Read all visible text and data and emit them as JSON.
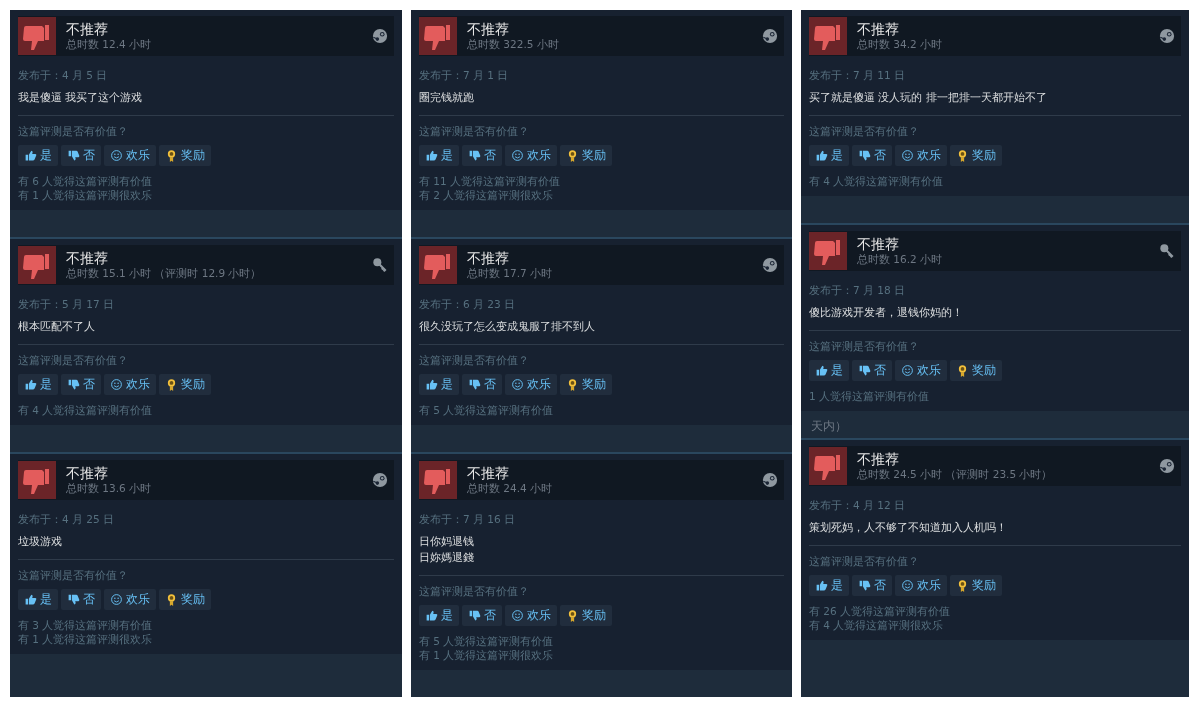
{
  "columns": [
    {
      "items": [
        {
          "kind": "review",
          "title": "不推荐",
          "hours": "总时数 12.4 小时",
          "key_activated": false,
          "date": "发布于：4 月 5 日",
          "text": "我是傻逼 我买了这个游戏",
          "question": "这篇评测是否有价值？",
          "buttons": [
            {
              "kind": "yes",
              "label": "是"
            },
            {
              "kind": "no",
              "label": "否"
            },
            {
              "kind": "funny",
              "label": "欢乐"
            },
            {
              "kind": "award",
              "label": "奖励"
            }
          ],
          "counts": [
            "有 6 人觉得这篇评测有价值",
            "有 1 人觉得这篇评测很欢乐"
          ]
        },
        {
          "kind": "gap"
        },
        {
          "kind": "review",
          "title": "不推荐",
          "hours": "总时数 15.1 小时 （评测时 12.9 小时）",
          "key_activated": true,
          "date": "发布于：5 月 17 日",
          "text": "根本匹配不了人",
          "question": "这篇评测是否有价值？",
          "buttons": [
            {
              "kind": "yes",
              "label": "是"
            },
            {
              "kind": "no",
              "label": "否"
            },
            {
              "kind": "funny",
              "label": "欢乐"
            },
            {
              "kind": "award",
              "label": "奖励"
            }
          ],
          "counts": [
            "有 4 人觉得这篇评测有价值"
          ]
        },
        {
          "kind": "gap"
        },
        {
          "kind": "review",
          "title": "不推荐",
          "hours": "总时数 13.6 小时",
          "key_activated": false,
          "date": "发布于：4 月 25 日",
          "text": "垃圾游戏",
          "question": "这篇评测是否有价值？",
          "buttons": [
            {
              "kind": "yes",
              "label": "是"
            },
            {
              "kind": "no",
              "label": "否"
            },
            {
              "kind": "funny",
              "label": "欢乐"
            },
            {
              "kind": "award",
              "label": "奖励"
            }
          ],
          "counts": [
            "有 3 人觉得这篇评测有价值",
            "有 1 人觉得这篇评测很欢乐"
          ]
        }
      ]
    },
    {
      "items": [
        {
          "kind": "review",
          "title": "不推荐",
          "hours": "总时数 322.5 小时",
          "key_activated": false,
          "date": "发布于：7 月 1 日",
          "text": "圈完钱就跑",
          "question": "这篇评测是否有价值？",
          "buttons": [
            {
              "kind": "yes",
              "label": "是"
            },
            {
              "kind": "no",
              "label": "否"
            },
            {
              "kind": "funny",
              "label": "欢乐"
            },
            {
              "kind": "award",
              "label": "奖励"
            }
          ],
          "counts": [
            "有 11 人觉得这篇评测有价值",
            "有 2 人觉得这篇评测很欢乐"
          ]
        },
        {
          "kind": "gap"
        },
        {
          "kind": "review",
          "title": "不推荐",
          "hours": "总时数 17.7 小时",
          "key_activated": false,
          "date": "发布于：6 月 23 日",
          "text": "很久没玩了怎么变成鬼服了排不到人",
          "question": "这篇评测是否有价值？",
          "buttons": [
            {
              "kind": "yes",
              "label": "是"
            },
            {
              "kind": "no",
              "label": "否"
            },
            {
              "kind": "funny",
              "label": "欢乐"
            },
            {
              "kind": "award",
              "label": "奖励"
            }
          ],
          "counts": [
            "有 5 人觉得这篇评测有价值"
          ]
        },
        {
          "kind": "gap"
        },
        {
          "kind": "review",
          "title": "不推荐",
          "hours": "总时数 24.4 小时",
          "key_activated": false,
          "date": "发布于：7 月 16 日",
          "text": "日你妈退钱",
          "text_2": "日妳媽退錢",
          "question": "这篇评测是否有价值？",
          "buttons": [
            {
              "kind": "yes",
              "label": "是"
            },
            {
              "kind": "no",
              "label": "否"
            },
            {
              "kind": "funny",
              "label": "欢乐"
            },
            {
              "kind": "award",
              "label": "奖励"
            }
          ],
          "counts": [
            "有 5 人觉得这篇评测有价值",
            "有 1 人觉得这篇评测很欢乐"
          ]
        }
      ]
    },
    {
      "items": [
        {
          "kind": "review",
          "title": "不推荐",
          "hours": "总时数 34.2 小时",
          "key_activated": false,
          "date": "发布于：7 月 11 日",
          "text": "买了就是傻逼 没人玩的 排一把排一天都开始不了",
          "question": "这篇评测是否有价值？",
          "buttons": [
            {
              "kind": "yes",
              "label": "是"
            },
            {
              "kind": "no",
              "label": "否"
            },
            {
              "kind": "funny",
              "label": "欢乐"
            },
            {
              "kind": "award",
              "label": "奖励"
            }
          ],
          "counts": [
            "有 4 人觉得这篇评测有价值"
          ]
        },
        {
          "kind": "gap"
        },
        {
          "kind": "review",
          "title": "不推荐",
          "hours": "总时数 16.2 小时",
          "key_activated": true,
          "date": "发布于：7 月 18 日",
          "text": "傻比游戏开发者，退钱你妈的！",
          "question": "这篇评测是否有价值？",
          "buttons": [
            {
              "kind": "yes",
              "label": "是"
            },
            {
              "kind": "no",
              "label": "否"
            },
            {
              "kind": "funny",
              "label": "欢乐"
            },
            {
              "kind": "award",
              "label": "奖励"
            }
          ],
          "counts": [
            "1 人觉得这篇评测有价值"
          ]
        },
        {
          "kind": "gap",
          "text": "天内）"
        },
        {
          "kind": "review",
          "title": "不推荐",
          "hours": "总时数 24.5 小时 （评测时 23.5 小时）",
          "key_activated": false,
          "date": "发布于：4 月 12 日",
          "text": "策划死妈，人不够了不知道加入人机吗！",
          "question": "这篇评测是否有价值？",
          "buttons": [
            {
              "kind": "yes",
              "label": "是"
            },
            {
              "kind": "no",
              "label": "否"
            },
            {
              "kind": "funny",
              "label": "欢乐"
            },
            {
              "kind": "award",
              "label": "奖励"
            }
          ],
          "counts": [
            "有 26 人觉得这篇评测有价值",
            "有 4 人觉得这篇评测很欢乐"
          ]
        }
      ]
    }
  ]
}
